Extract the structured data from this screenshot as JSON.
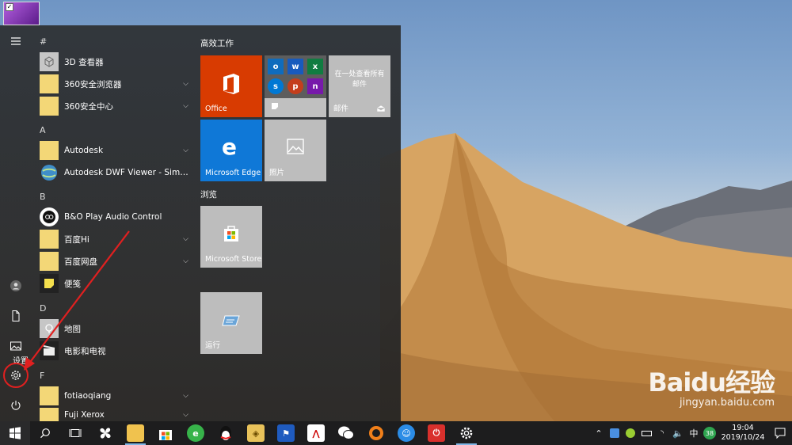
{
  "start": {
    "headers": {
      "hash": "#",
      "a": "A",
      "b": "B",
      "d": "D",
      "f": "F"
    },
    "apps": [
      {
        "label": "3D 查看器",
        "expandable": false
      },
      {
        "label": "360安全浏览器",
        "expandable": true
      },
      {
        "label": "360安全中心",
        "expandable": true
      },
      {
        "label": "Autodesk",
        "expandable": true
      },
      {
        "label": "Autodesk DWF Viewer - Simplifie...",
        "expandable": false
      },
      {
        "label": "B&O Play Audio Control",
        "expandable": false
      },
      {
        "label": "百度Hi",
        "expandable": true
      },
      {
        "label": "百度网盘",
        "expandable": true
      },
      {
        "label": "便笺",
        "expandable": false
      },
      {
        "label": "地图",
        "expandable": false
      },
      {
        "label": "电影和电视",
        "expandable": false
      },
      {
        "label": "fotiaoqiang",
        "expandable": true
      },
      {
        "label": "Fuji Xerox",
        "expandable": true
      }
    ],
    "rail": {
      "settings_tooltip": "设置"
    },
    "groups": {
      "productivity": "高效工作",
      "browse": "浏览"
    },
    "tiles": {
      "office": "Office",
      "mail_message": "在一处查看所有邮件",
      "mail": "邮件",
      "edge": "Microsoft Edge",
      "photos": "照片",
      "store": "Microsoft Store",
      "run": "运行"
    },
    "mini_tiles": [
      "o",
      "w",
      "x",
      "s",
      "p",
      "n"
    ]
  },
  "taskbar": {
    "ime": "中",
    "badge_count": "38",
    "time": "19:04",
    "date": "2019/10/24"
  },
  "watermark": {
    "logo": "Baidu经验",
    "url": "jingyan.baidu.com"
  },
  "colors": {
    "office_tile": "#d83b01",
    "edge_tile": "#0f78d7",
    "gray_tile": "#c0c0c0",
    "annotation_red": "#e02020",
    "folder": "#f3d777"
  }
}
